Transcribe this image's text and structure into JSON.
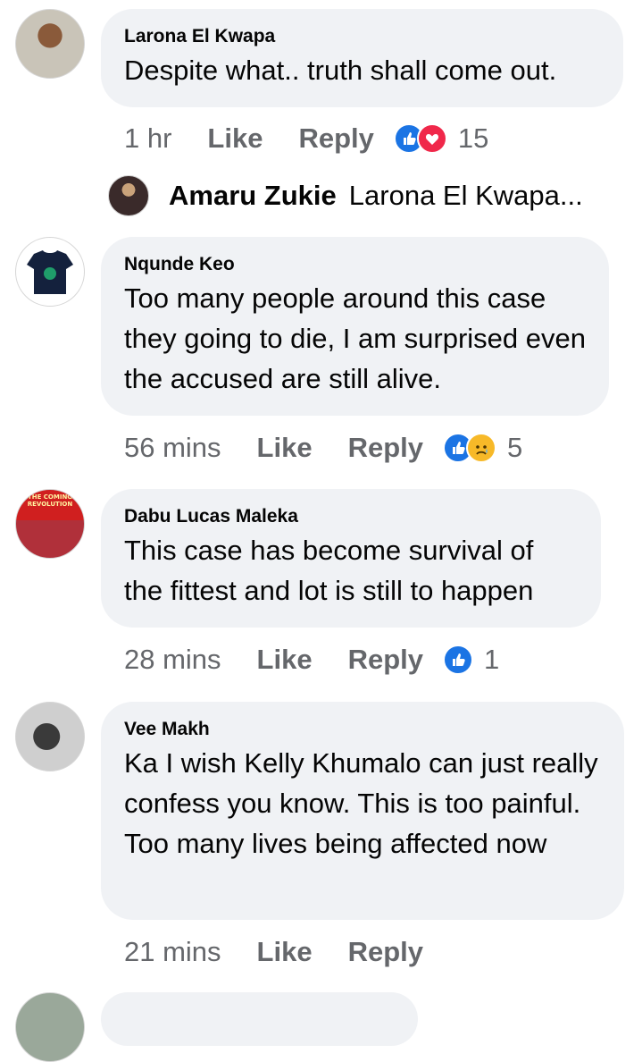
{
  "comments": [
    {
      "author": "Larona El Kwapa",
      "text": "Despite what.. truth shall come out.",
      "time": "1 hr",
      "like_label": "Like",
      "reply_label": "Reply",
      "reactions": [
        "like",
        "love"
      ],
      "reaction_count": "15"
    },
    {
      "author": "Nqunde Keo",
      "text": "Too many people around this case they going to die, I am surprised even the accused are still alive.",
      "time": "56 mins",
      "like_label": "Like",
      "reply_label": "Reply",
      "reactions": [
        "like",
        "sad"
      ],
      "reaction_count": "5"
    },
    {
      "author": "Dabu Lucas Maleka",
      "avatar_text": "THE COMING REVOLUTION",
      "text": "This case has become survival of the fittest and lot is still to happen",
      "time": "28 mins",
      "like_label": "Like",
      "reply_label": "Reply",
      "reactions": [
        "like"
      ],
      "reaction_count": "1"
    },
    {
      "author": "Vee Makh",
      "text": "Ka I wish Kelly Khumalo can just really confess you know. This is too painful. Too many lives being affected now",
      "time": "21 mins",
      "like_label": "Like",
      "reply_label": "Reply"
    }
  ],
  "reply_preview": {
    "author": "Amaru Zukie",
    "text": "Larona El Kwapa..."
  },
  "colors": {
    "bubble": "#f0f2f5",
    "meta": "#65676b",
    "like_blue": "#1b74e4",
    "love_red": "#f0284a",
    "sad_yellow": "#f7b928"
  }
}
